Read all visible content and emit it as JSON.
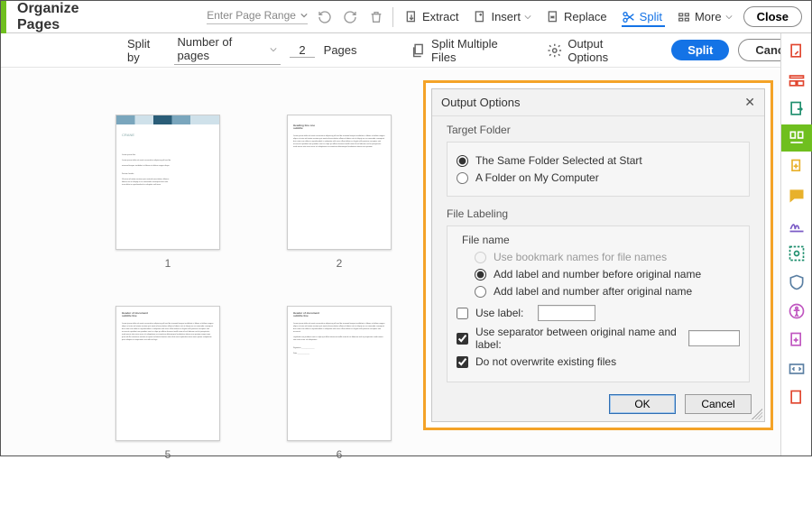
{
  "topbar": {
    "title": "Organize Pages",
    "page_range_placeholder": "Enter Page Range",
    "tools": {
      "extract": "Extract",
      "insert": "Insert",
      "replace": "Replace",
      "split": "Split",
      "more": "More"
    },
    "close": "Close"
  },
  "subbar": {
    "split_by": "Split by",
    "mode": "Number of pages",
    "count": "2",
    "pages": "Pages",
    "split_multiple": "Split Multiple Files",
    "output_options": "Output Options",
    "split": "Split",
    "cancel": "Cancel"
  },
  "thumbs": [
    "1",
    "2",
    "",
    "5",
    "6",
    ""
  ],
  "dialog": {
    "title": "Output Options",
    "target_folder_label": "Target Folder",
    "target_same": "The Same Folder Selected at Start",
    "target_choose": "A Folder on My Computer",
    "file_labeling_label": "File Labeling",
    "file_name_label": "File name",
    "use_bookmark": "Use bookmark names for file names",
    "label_before": "Add label and number before original name",
    "label_after": "Add label and number after original name",
    "use_label": "Use label:",
    "use_separator": "Use separator between original name and label:",
    "no_overwrite": "Do not overwrite existing files",
    "ok": "OK",
    "cancel": "Cancel"
  },
  "rail_icons": [
    "create-pdf",
    "panel",
    "export",
    "organize",
    "combine",
    "comment",
    "sign",
    "redact",
    "protect",
    "accessibility",
    "add",
    "code",
    "more"
  ]
}
